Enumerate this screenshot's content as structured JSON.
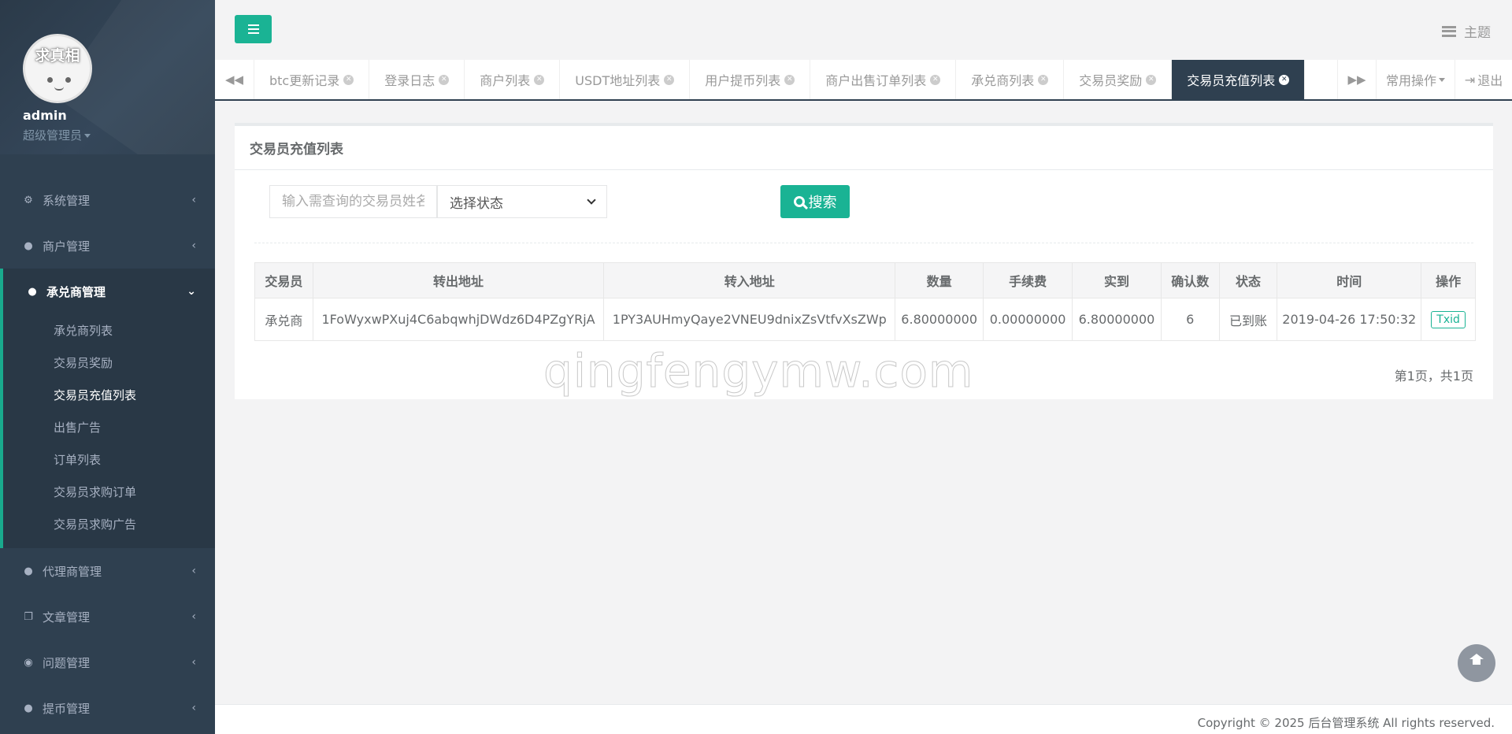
{
  "profile": {
    "avatar_text": "求真相",
    "name": "admin",
    "role": "超级管理员"
  },
  "sidebar": {
    "items": [
      {
        "label": "系统管理",
        "icon": "gear-icon"
      },
      {
        "label": "商户管理",
        "icon": "user-icon"
      },
      {
        "label": "承兑商管理",
        "icon": "user-icon",
        "expanded": true,
        "children": [
          "承兑商列表",
          "交易员奖励",
          "交易员充值列表",
          "出售广告",
          "订单列表",
          "交易员求购订单",
          "交易员求购广告"
        ],
        "active_child": "交易员充值列表"
      },
      {
        "label": "代理商管理",
        "icon": "user-icon"
      },
      {
        "label": "文章管理",
        "icon": "copy-icon"
      },
      {
        "label": "问题管理",
        "icon": "comment-icon"
      },
      {
        "label": "提币管理",
        "icon": "user-icon"
      }
    ]
  },
  "header": {
    "theme_label": "主题"
  },
  "tabs": {
    "items": [
      "btc更新记录",
      "登录日志",
      "商户列表",
      "USDT地址列表",
      "用户提币列表",
      "商户出售订单列表",
      "承兑商列表",
      "交易员奖励",
      "交易员充值列表"
    ],
    "active": "交易员充值列表",
    "ops_label": "常用操作",
    "exit_label": "退出"
  },
  "panel": {
    "title": "交易员充值列表",
    "search_placeholder": "输入需查询的交易员姓名",
    "status_select": "选择状态",
    "search_button": "搜索",
    "columns": [
      "交易员",
      "转出地址",
      "转入地址",
      "数量",
      "手续费",
      "实到",
      "确认数",
      "状态",
      "时间",
      "操作"
    ],
    "rows": [
      [
        "承兑商",
        "1FoWyxwPXuj4C6abqwhjDWdz6D4PZgYRjA",
        "1PY3AUHmyQaye2VNEU9dnixZsVtfvXsZWp",
        "6.80000000",
        "0.00000000",
        "6.80000000",
        "6",
        "已到账",
        "2019-04-26 17:50:32",
        "Txid"
      ]
    ],
    "pagination": "第1页，共1页"
  },
  "watermark": "qingfengymw.com",
  "footer": "Copyright © 2025 后台管理系统 All rights reserved.",
  "colors": {
    "sidebar_bg": "#2f4050",
    "accent": "#1ab394",
    "active_tab": "#2f4050"
  }
}
